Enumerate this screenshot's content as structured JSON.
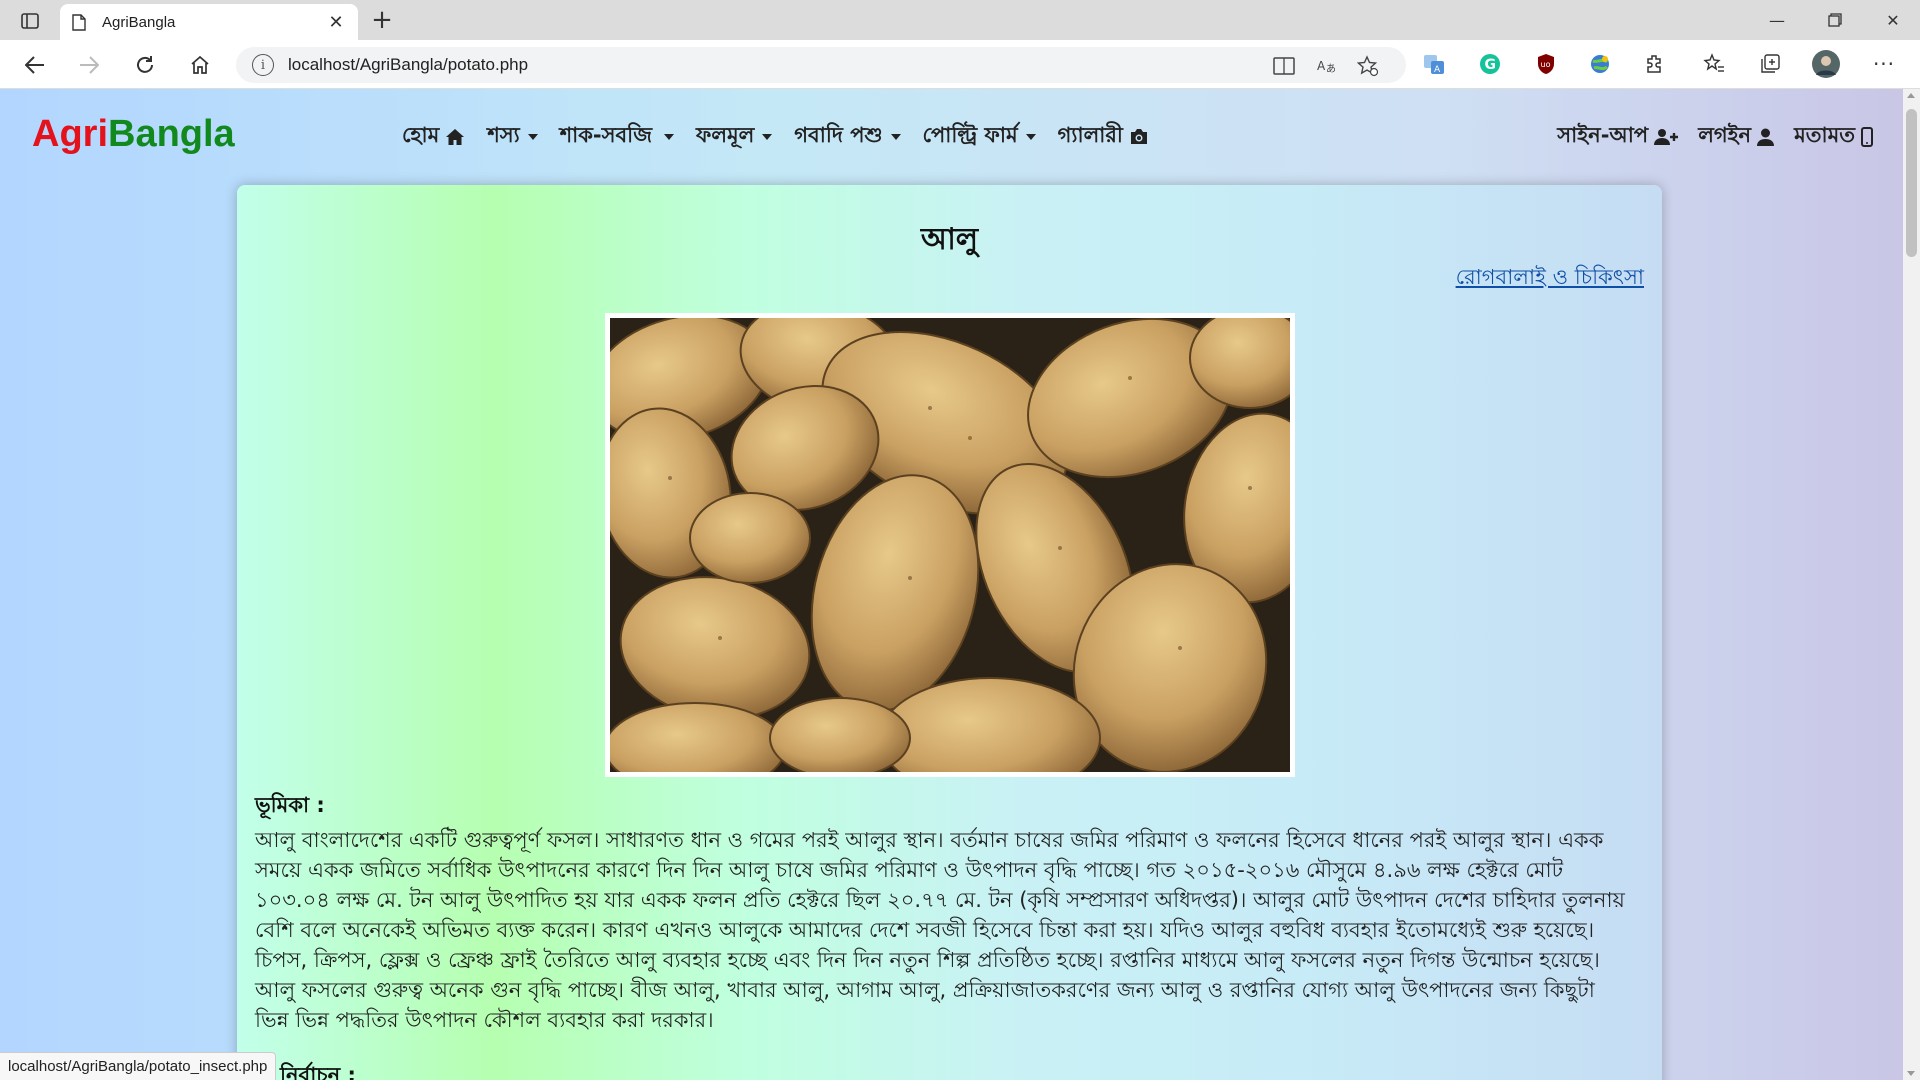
{
  "browser": {
    "tab_title": "AgriBangla",
    "url": "localhost/AgriBangla/potato.php",
    "new_tab": "+",
    "status_url": "localhost/AgriBangla/potato_insect.php",
    "icons": [
      "sidebar-icon",
      "page-icon",
      "close-icon",
      "back-icon",
      "forward-icon",
      "reload-icon",
      "home-icon",
      "info-icon",
      "reader-view-icon",
      "read-aloud-icon",
      "add-favorite-icon",
      "translate-icon",
      "grammarly-icon",
      "ublock-icon",
      "globe-extension-icon",
      "extensions-icon",
      "favorites-icon",
      "collections-icon",
      "profile-avatar",
      "more-icon"
    ]
  },
  "site": {
    "brand_part1": "Agri",
    "brand_part2": "Bangla",
    "brand_colors": {
      "agri": "#e3121b",
      "bangla": "#12891c"
    },
    "nav": [
      {
        "label": "হোম",
        "icon": "home-icon"
      },
      {
        "label": "শস্য",
        "dropdown": true
      },
      {
        "label": "শাক-সবজি",
        "dropdown": true
      },
      {
        "label": "ফলমূল",
        "dropdown": true
      },
      {
        "label": "গবাদি পশু",
        "dropdown": true
      },
      {
        "label": "পোল্ট্রি ফার্ম",
        "dropdown": true
      },
      {
        "label": "গ্যালারী",
        "icon": "camera-icon"
      }
    ],
    "nav_right": [
      {
        "label": "সাইন-আপ",
        "icon": "user-plus-icon"
      },
      {
        "label": "লগইন",
        "icon": "user-icon"
      },
      {
        "label": "মতামত",
        "icon": "mobile-icon"
      }
    ]
  },
  "content": {
    "title": "আলু",
    "disease_link": "রোগবালাই ও চিকিৎসা",
    "image_subject": "potatoes-photo",
    "intro_heading": "ভূমিকা :",
    "intro_text": "আলু বাংলাদেশের একটি গুরুত্বপূর্ণ ফসল। সাধারণত ধান ও গমের পরই আলুর স্থান। বর্তমান চাষের জমির পরিমাণ ও ফলনের হিসেবে ধানের পরই আলুর স্থান। একক সময়ে একক জমিতে সর্বাধিক উৎপাদনের কারণে দিন দিন আলু চাষে জমির পরিমাণ ও উৎপাদন বৃদ্ধি পাচ্ছে। গত ২০১৫-২০১৬ মৌসুমে ৪.৯৬ লক্ষ হেক্টরে মোট ১০৩.০৪ লক্ষ মে. টন আলু উৎপাদিত হয় যার একক ফলন প্রতি হেক্টরে ছিল ২০.৭৭ মে. টন (কৃষি সম্প্রসারণ অধিদপ্তর)। আলুর মোট উৎপাদন দেশের চাহিদার তুলনায় বেশি বলে অনেকেই অভিমত ব্যক্ত করেন। কারণ এখনও আলুকে আমাদের দেশে সবজী হিসেবে চিন্তা করা হয়। যদিও আলুর বহুবিধ ব্যবহার ইতোমধ্যেই শুরু হয়েছে। চিপস, ক্রিপস, ফ্লেক্স ও ফ্রেঞ্চ ফ্রাই তৈরিতে আলু ব্যবহার হচ্ছে এবং দিন দিন নতুন শিল্প প্রতিষ্ঠিত হচ্ছে। রপ্তানির মাধ্যমে আলু ফসলের নতুন দিগন্ত উন্মোচন হয়েছে। আলু ফসলের গুরুত্ব অনেক গুন বৃদ্ধি পাচ্ছে। বীজ আলু, খাবার আলু, আগাম আলু, প্রক্রিয়াজাতকরণের জন্য আলু ও রপ্তানির যোগ্য আলু উৎপাদনের জন্য কিছুটা ভিন্ন ভিন্ন পদ্ধতির উৎপাদন কৌশল ব্যবহার করা দরকার।",
    "next_heading": "মি নির্বাচন :"
  }
}
